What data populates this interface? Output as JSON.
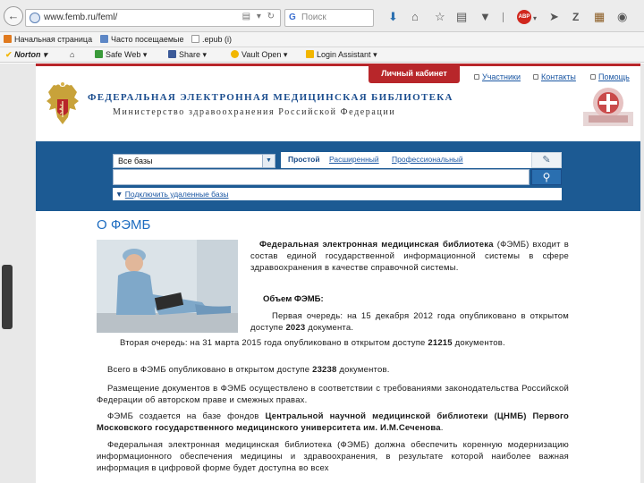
{
  "browser": {
    "back_icon": "back-arrow-icon",
    "url": "www.femb.ru/feml/",
    "search_placeholder": "Поиск",
    "search_engine_icon": "google-icon",
    "toolbar_icons": [
      "download-icon",
      "home-icon",
      "star-icon",
      "reading-list-icon",
      "pocket-icon",
      "adblock-icon",
      "send-icon",
      "zotero-icon",
      "book-icon",
      "chat-icon"
    ]
  },
  "bookmarks": {
    "items": [
      {
        "label": "Начальная страница",
        "icon": "firefox-icon"
      },
      {
        "label": "Часто посещаемые",
        "icon": "bookmark-icon"
      },
      {
        "label": ".epub (i)",
        "icon": "page-icon"
      }
    ]
  },
  "norton_bar": {
    "norton_label": "Norton",
    "safe_web_label": "Safe Web",
    "share_label": "Share",
    "vault_label": "Vault Open",
    "login_label": "Login Assistant"
  },
  "site": {
    "cabinet_label": "Личный кабинет",
    "participants_label": "Участники",
    "contacts_label": "Контакты",
    "help_label": "Помощь",
    "title": "ФЕДЕРАЛЬНАЯ ЭЛЕКТРОННАЯ МЕДИЦИНСКАЯ БИБЛИОТЕКА",
    "subtitle": "Министерство здравоохранения Российской Федерации",
    "colors": {
      "accent_red": "#b8262a",
      "panel_blue": "#1c5a93",
      "link_blue": "#1b57a3"
    }
  },
  "search": {
    "db_selected": "Все базы",
    "modes": [
      "Простой",
      "Расширенный",
      "Профессиональный"
    ],
    "query_value": "",
    "remote_link": "Подключить удаленные базы"
  },
  "content": {
    "heading": "О ФЭМБ",
    "intro_bold": "Федеральная электронная медицинская библиотека",
    "intro_rest": "(ФЭМБ) входит в состав единой государственной информационной системы в сфере здравоохранения в качестве справочной системы.",
    "volume_heading": "Объем ФЭМБ:",
    "stage1_a": "Первая очередь: на 15 декабря 2012 года опубликовано в открытом доступе ",
    "stage1_num": "2023",
    "stage1_b": " документа.",
    "stage2_a": "Вторая очередь: на 31 марта 2015 года опубликовано в открытом доступе ",
    "stage2_num": "21215",
    "stage2_b": " документов.",
    "total_a": "Всего в ФЭМБ опубликовано в открытом доступе ",
    "total_num": "23238",
    "total_b": " документов.",
    "placement": "Размещение документов в ФЭМБ осуществлено в соответствии с требованиями законодательства Российской Федерации об авторском праве и смежных правах.",
    "funds_a": "ФЭМБ создается на базе фондов ",
    "funds_bold": "Центральной научной медицинской библиотеки (ЦНМБ) Первого Московского государственного медицинского университета им. И.М.Сеченова",
    "funds_b": ".",
    "modernize": "Федеральная электронная медицинская библиотека (ФЭМБ) должна обеспечить коренную модернизацию информационного обеспечения медицины и здравоохранения, в результате которой наиболее важная информация в цифровой форме будет доступна во всех"
  }
}
